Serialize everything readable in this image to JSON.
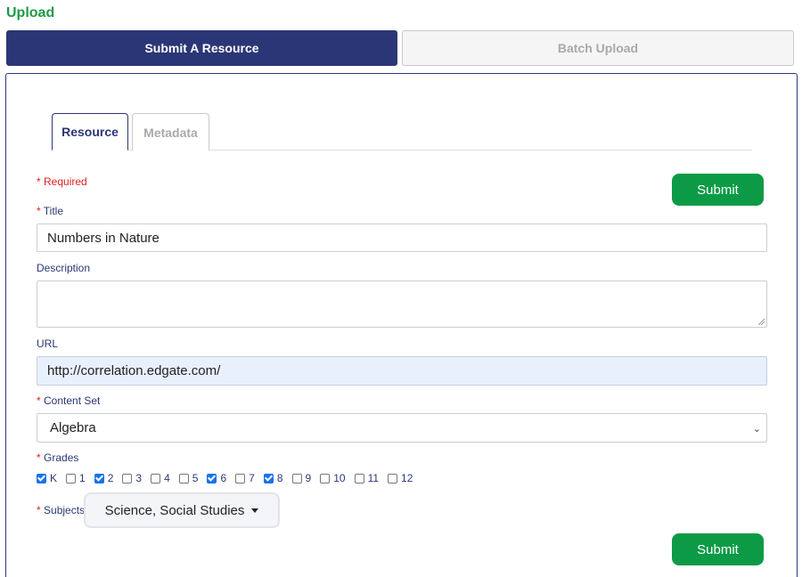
{
  "page": {
    "heading": "Upload"
  },
  "mode_tabs": {
    "submit_resource": "Submit A Resource",
    "batch_upload": "Batch Upload"
  },
  "form_tabs": {
    "resource": "Resource",
    "metadata": "Metadata"
  },
  "form": {
    "required_note": "Required",
    "required_marker": "*",
    "submit_label": "Submit",
    "title": {
      "label": "Title",
      "value": "Numbers in Nature"
    },
    "description": {
      "label": "Description",
      "value": ""
    },
    "url": {
      "label": "URL",
      "value": "http://correlation.edgate.com/"
    },
    "content_set": {
      "label": "Content Set",
      "value": "Algebra"
    },
    "grades": {
      "label": "Grades",
      "items": [
        {
          "label": "K",
          "checked": true
        },
        {
          "label": "1",
          "checked": false
        },
        {
          "label": "2",
          "checked": true
        },
        {
          "label": "3",
          "checked": false
        },
        {
          "label": "4",
          "checked": false
        },
        {
          "label": "5",
          "checked": false
        },
        {
          "label": "6",
          "checked": true
        },
        {
          "label": "7",
          "checked": false
        },
        {
          "label": "8",
          "checked": true
        },
        {
          "label": "9",
          "checked": false
        },
        {
          "label": "10",
          "checked": false
        },
        {
          "label": "11",
          "checked": false
        },
        {
          "label": "12",
          "checked": false
        }
      ]
    },
    "subjects": {
      "label": "Subjects",
      "value": "Science, Social Studies"
    }
  },
  "colors": {
    "accent_green": "#0c9a46",
    "navy": "#2b3676",
    "required_red": "#e02020"
  }
}
